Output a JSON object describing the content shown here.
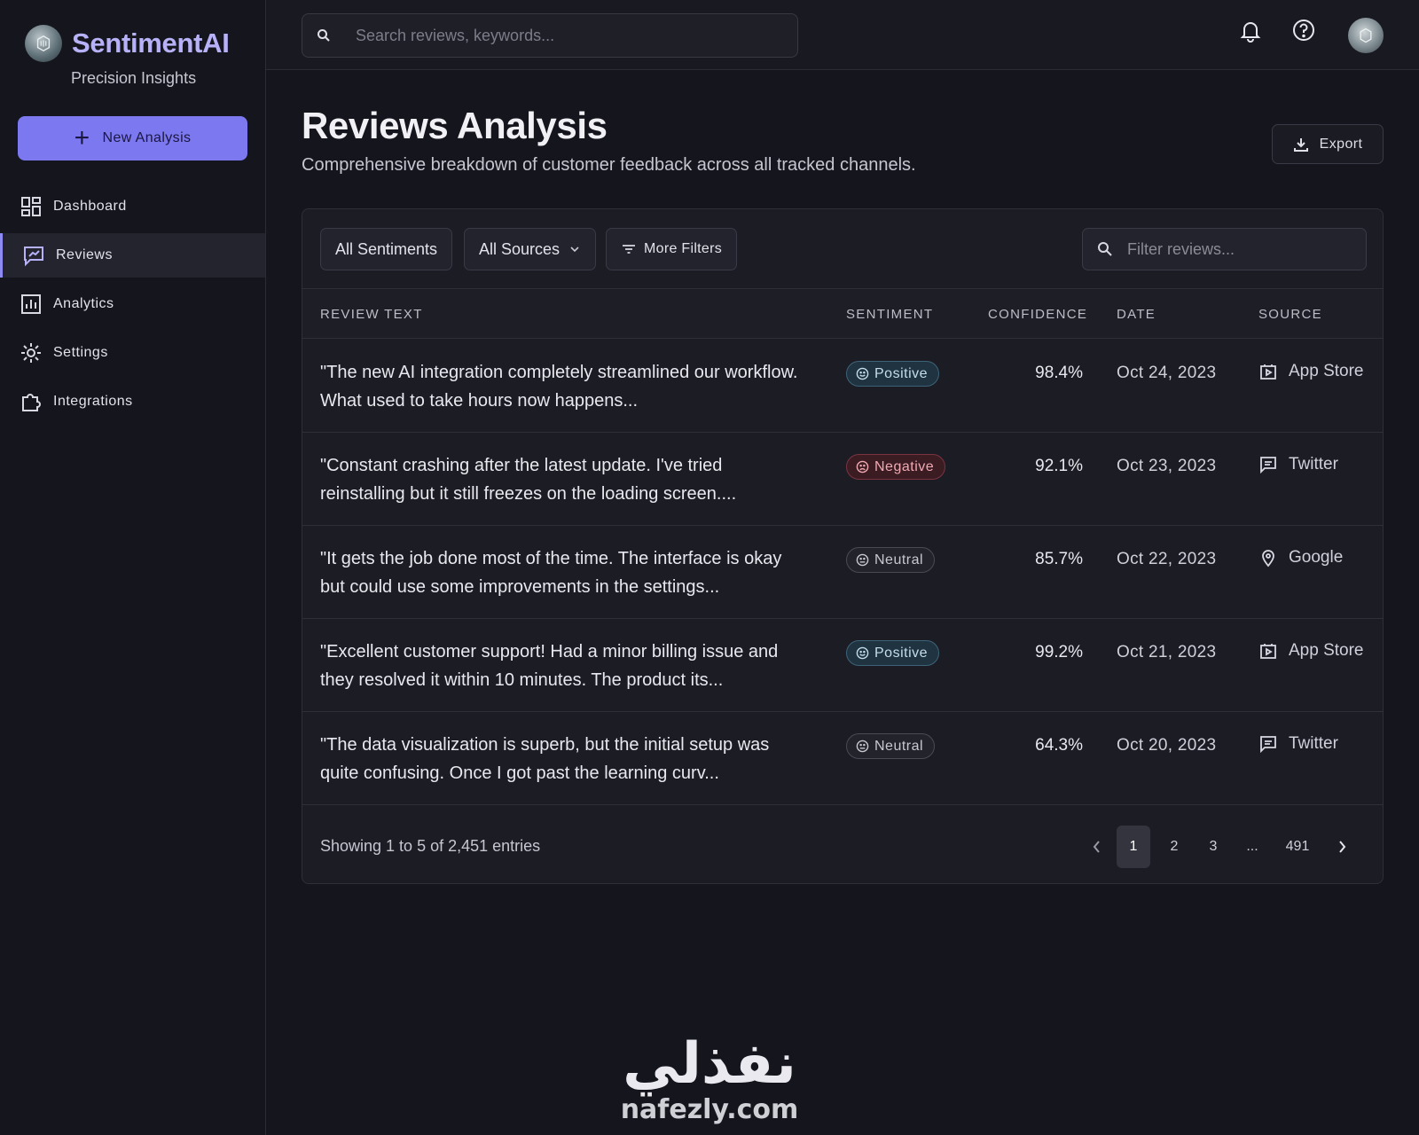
{
  "brand": {
    "name": "SentimentAI",
    "tagline": "Precision Insights",
    "new_button": "New Analysis"
  },
  "nav": [
    {
      "label": "Dashboard",
      "icon": "dashboard-icon",
      "active": false
    },
    {
      "label": "Reviews",
      "icon": "reviews-icon",
      "active": true
    },
    {
      "label": "Analytics",
      "icon": "analytics-icon",
      "active": false
    },
    {
      "label": "Settings",
      "icon": "gear-icon",
      "active": false
    },
    {
      "label": "Integrations",
      "icon": "puzzle-icon",
      "active": false
    }
  ],
  "topbar": {
    "search_placeholder": "Search reviews, keywords...",
    "icons": [
      "bell-icon",
      "help-icon",
      "avatar"
    ]
  },
  "page": {
    "title": "Reviews Analysis",
    "subtitle": "Comprehensive breakdown of customer feedback across all tracked channels.",
    "export_label": "Export"
  },
  "filters": {
    "sentiment": "All Sentiments",
    "sources": "All Sources",
    "more": "More Filters",
    "filter_placeholder": "Filter reviews..."
  },
  "table": {
    "headers": [
      "REVIEW TEXT",
      "SENTIMENT",
      "CONFIDENCE",
      "DATE",
      "SOURCE"
    ],
    "rows": [
      {
        "text": "\"The new AI integration completely streamlined our workflow. What used to take hours now happens...",
        "sentiment": "Positive",
        "confidence": "98.4%",
        "date": "Oct 24, 2023",
        "source": "App Store"
      },
      {
        "text": "\"Constant crashing after the latest update. I've tried reinstalling but it still freezes on the loading screen....",
        "sentiment": "Negative",
        "confidence": "92.1%",
        "date": "Oct 23, 2023",
        "source": "Twitter"
      },
      {
        "text": "\"It gets the job done most of the time. The interface is okay but could use some improvements in the settings...",
        "sentiment": "Neutral",
        "confidence": "85.7%",
        "date": "Oct 22, 2023",
        "source": "Google"
      },
      {
        "text": "\"Excellent customer support! Had a minor billing issue and they resolved it within 10 minutes. The product its...",
        "sentiment": "Positive",
        "confidence": "99.2%",
        "date": "Oct 21, 2023",
        "source": "App Store"
      },
      {
        "text": "\"The data visualization is superb, but the initial setup was quite confusing. Once I got past the learning curv...",
        "sentiment": "Neutral",
        "confidence": "64.3%",
        "date": "Oct 20, 2023",
        "source": "Twitter"
      }
    ]
  },
  "pagination": {
    "showing": "Showing 1 to 5 of 2,451 entries",
    "pages": [
      "1",
      "2",
      "3",
      "...",
      "491"
    ],
    "current": "1"
  },
  "watermark": {
    "arabic": "نفذلي",
    "latin": "nafezly.com"
  },
  "colors": {
    "accent": "#7b78f0",
    "brand_text": "#b7b2f7",
    "positive": "#3d6379",
    "negative": "#7a3440",
    "neutral": "#4a4a55",
    "background": "#15151d"
  }
}
